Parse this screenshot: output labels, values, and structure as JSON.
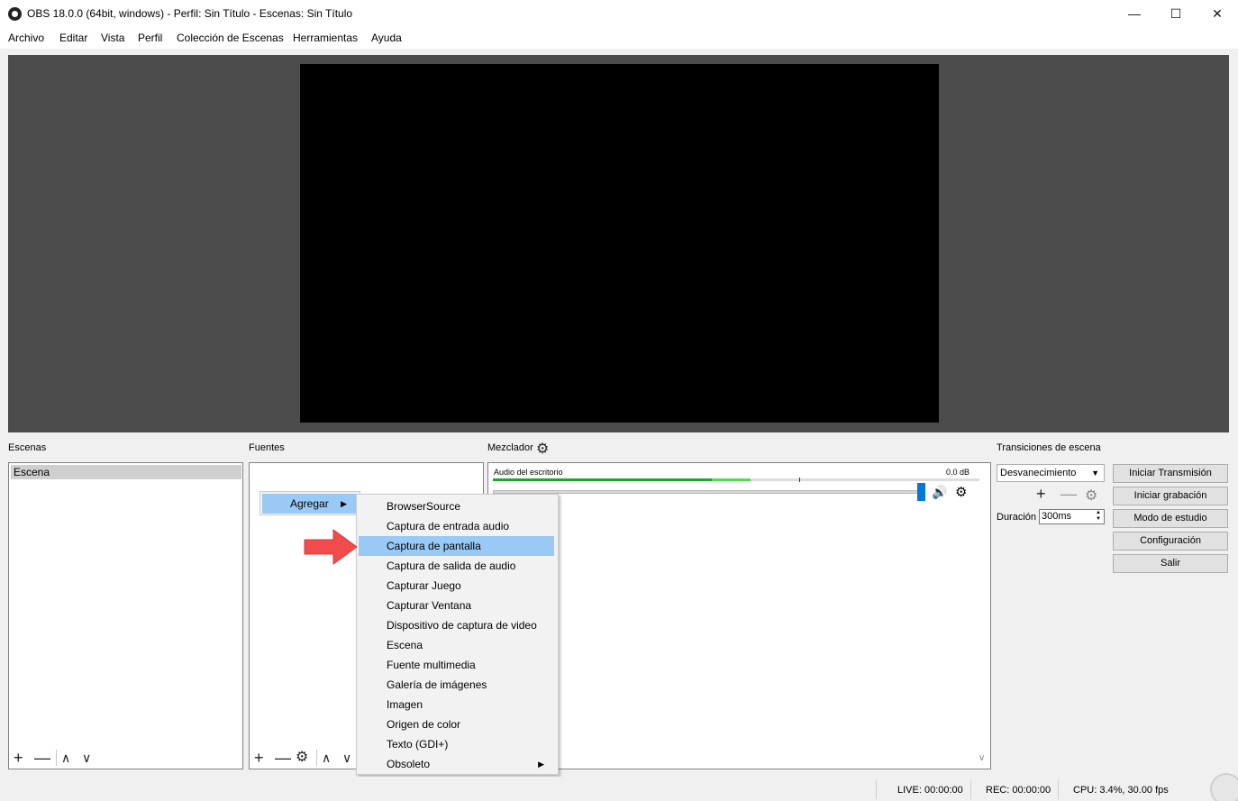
{
  "window": {
    "title": "OBS 18.0.0 (64bit, windows) - Perfil: Sin Título - Escenas: Sin Título",
    "minimize": "—",
    "maximize": "☐",
    "close": "✕"
  },
  "menubar": [
    "Archivo",
    "Editar",
    "Vista",
    "Perfil",
    "Colección de Escenas",
    "Herramientas",
    "Ayuda"
  ],
  "scenes": {
    "title": "Escenas",
    "items": [
      "Escena"
    ],
    "toolbar": {
      "add": "+",
      "remove": "—",
      "up": "∧",
      "down": "∨"
    }
  },
  "sources": {
    "title": "Fuentes",
    "toolbar": {
      "add": "+",
      "remove": "—",
      "settings": "⚙",
      "up": "∧",
      "down": "∨"
    }
  },
  "mixer": {
    "title": "Mezclador",
    "channel": {
      "name": "Audio del escritorio",
      "db": "0.0 dB",
      "meter_level": 0.45,
      "meter_peak": 0.53,
      "volume": 1.0
    }
  },
  "transitions": {
    "title": "Transiciones de escena",
    "selected": "Desvanecimiento",
    "duration_label": "Duración",
    "duration_value": "300ms"
  },
  "controls": [
    "Iniciar Transmisión",
    "Iniciar grabación",
    "Modo de estudio",
    "Configuración",
    "Salir"
  ],
  "context_menu": {
    "label": "Agregar"
  },
  "submenu": {
    "items": [
      "BrowserSource",
      "Captura de entrada audio",
      "Captura de pantalla",
      "Captura de salida de audio",
      "Capturar Juego",
      "Capturar Ventana",
      "Dispositivo de captura de video",
      "Escena",
      "Fuente multimedia",
      "Galería de imágenes",
      "Imagen",
      "Origen de color",
      "Texto (GDI+)",
      "Obsoleto"
    ],
    "highlighted": "Captura de pantalla"
  },
  "status": {
    "live": "LIVE: 00:00:00",
    "rec": "REC: 00:00:00",
    "cpu": "CPU: 3.4%, 30.00 fps"
  },
  "colors": {
    "highlight": "#99c9f5",
    "preview_bg": "#4c4c4c",
    "arrow": "#f24b4b",
    "meter_green": "#22a633",
    "volume_handle": "#0078d7"
  }
}
